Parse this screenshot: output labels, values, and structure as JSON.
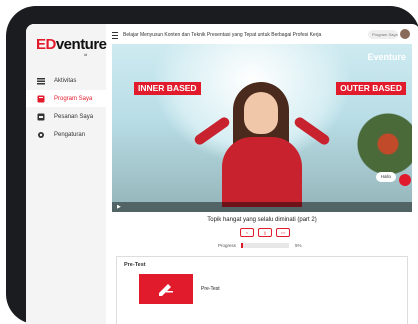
{
  "app": {
    "logo_main": "Eventure",
    "logo_sub": "id",
    "logo_prefix": "ED",
    "logo_rest": "venture"
  },
  "sidebar": {
    "items": [
      {
        "label": "Aktivitas",
        "icon": "list-icon",
        "active": false
      },
      {
        "label": "Program Saya",
        "icon": "book-icon",
        "active": true
      },
      {
        "label": "Pesanan Saya",
        "icon": "cart-icon",
        "active": false
      },
      {
        "label": "Pengaturan",
        "icon": "gear-icon",
        "active": false
      }
    ]
  },
  "header": {
    "course_title": "Belajar Menyusun Konten dan Teknik Presentasi yang Tepat untuk Berbagai Profesi Kerja",
    "user_label": "Program Saya"
  },
  "video": {
    "brand": "Eventure",
    "label_left": "INNER BASED",
    "label_right": "OUTER BASED",
    "hello_chip": "Hallo"
  },
  "lesson": {
    "title": "Topik hangat yang selalu diminati (part 2)",
    "controls": [
      "<",
      "||",
      ">>"
    ],
    "progress_label": "Progress",
    "progress_value": 5,
    "progress_text": "5%"
  },
  "pretest": {
    "heading": "Pre-Test",
    "tile_label": "Pre-Test"
  },
  "colors": {
    "brand_red": "#e21b2c",
    "frame": "#1b1c1f"
  }
}
